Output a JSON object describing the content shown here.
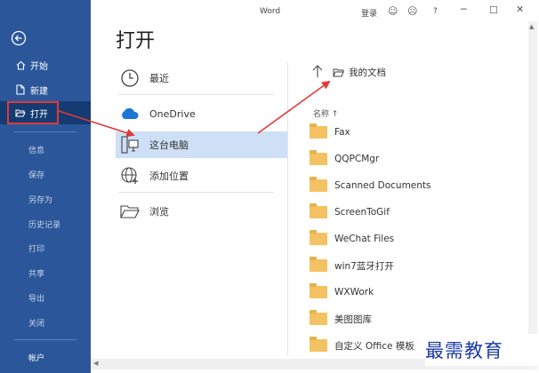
{
  "app": {
    "title": "Word",
    "user": "登录",
    "help": "?"
  },
  "nav": {
    "back_icon": "back-arrow-icon",
    "primary": [
      {
        "label": "开始",
        "icon": "home-icon"
      },
      {
        "label": "新建",
        "icon": "new-doc-icon"
      },
      {
        "label": "打开",
        "icon": "open-folder-icon",
        "selected": true
      }
    ],
    "secondary": [
      "信息",
      "保存",
      "另存为",
      "历史记录",
      "打印",
      "共享",
      "导出",
      "关闭"
    ],
    "account": "帐户"
  },
  "page": {
    "title": "打开"
  },
  "places": [
    {
      "label": "最近",
      "icon": "clock-icon"
    },
    {
      "label": "OneDrive",
      "icon": "cloud-icon"
    },
    {
      "label": "这台电脑",
      "icon": "pc-icon",
      "selected": true
    },
    {
      "label": "添加位置",
      "icon": "globe-icon"
    },
    {
      "label": "浏览",
      "icon": "folder-outline-icon"
    }
  ],
  "browser": {
    "path": "我的文档",
    "column_header": "名称 ↑",
    "folders": [
      "Fax",
      "QQPCMgr",
      "Scanned Documents",
      "ScreenToGif",
      "WeChat Files",
      "win7蓝牙打开",
      "WXWork",
      "美图图库",
      "自定义 Office 模板"
    ]
  },
  "watermark": "最需教育",
  "colors": {
    "nav": "#2b579a",
    "selected_place": "#cde0f5",
    "folder": "#f4c263",
    "highlight": "#e03a3a"
  }
}
